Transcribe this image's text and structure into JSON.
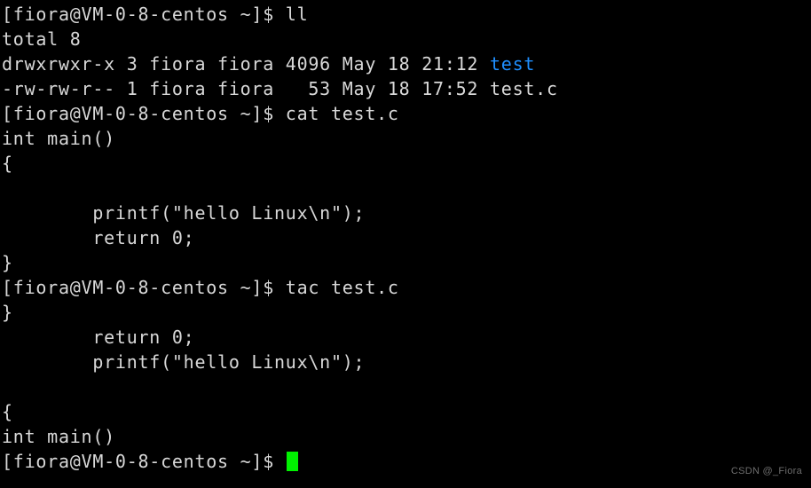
{
  "terminal": {
    "background_color": "#000000",
    "foreground_color": "#d8d8d8",
    "dir_color": "#1f8fff",
    "cursor_color": "#00f200",
    "prompt": "[fiora@VM-0-8-centos ~]$ ",
    "lines": [
      {
        "type": "prompt",
        "prompt": "[fiora@VM-0-8-centos ~]$ ",
        "command": "ll"
      },
      {
        "type": "output",
        "text": "total 8"
      },
      {
        "type": "listing",
        "prefix": "drwxrwxr-x 3 fiora fiora 4096 May 18 21:12 ",
        "name": "test",
        "color": "dir"
      },
      {
        "type": "listing",
        "prefix": "-rw-rw-r-- 1 fiora fiora   53 May 18 17:52 ",
        "name": "test.c",
        "color": "default"
      },
      {
        "type": "prompt",
        "prompt": "[fiora@VM-0-8-centos ~]$ ",
        "command": "cat test.c"
      },
      {
        "type": "output",
        "text": "int main()"
      },
      {
        "type": "output",
        "text": "{"
      },
      {
        "type": "output",
        "text": ""
      },
      {
        "type": "output",
        "text": "        printf(\"hello Linux\\n\");"
      },
      {
        "type": "output",
        "text": "        return 0;"
      },
      {
        "type": "output",
        "text": "}"
      },
      {
        "type": "prompt",
        "prompt": "[fiora@VM-0-8-centos ~]$ ",
        "command": "tac test.c"
      },
      {
        "type": "output",
        "text": "}"
      },
      {
        "type": "output",
        "text": "        return 0;"
      },
      {
        "type": "output",
        "text": "        printf(\"hello Linux\\n\");"
      },
      {
        "type": "output",
        "text": ""
      },
      {
        "type": "output",
        "text": "{"
      },
      {
        "type": "output",
        "text": "int main()"
      },
      {
        "type": "cursor-prompt",
        "prompt": "[fiora@VM-0-8-centos ~]$ ",
        "command": ""
      }
    ]
  },
  "watermark": {
    "text": "CSDN @_Fiora"
  }
}
